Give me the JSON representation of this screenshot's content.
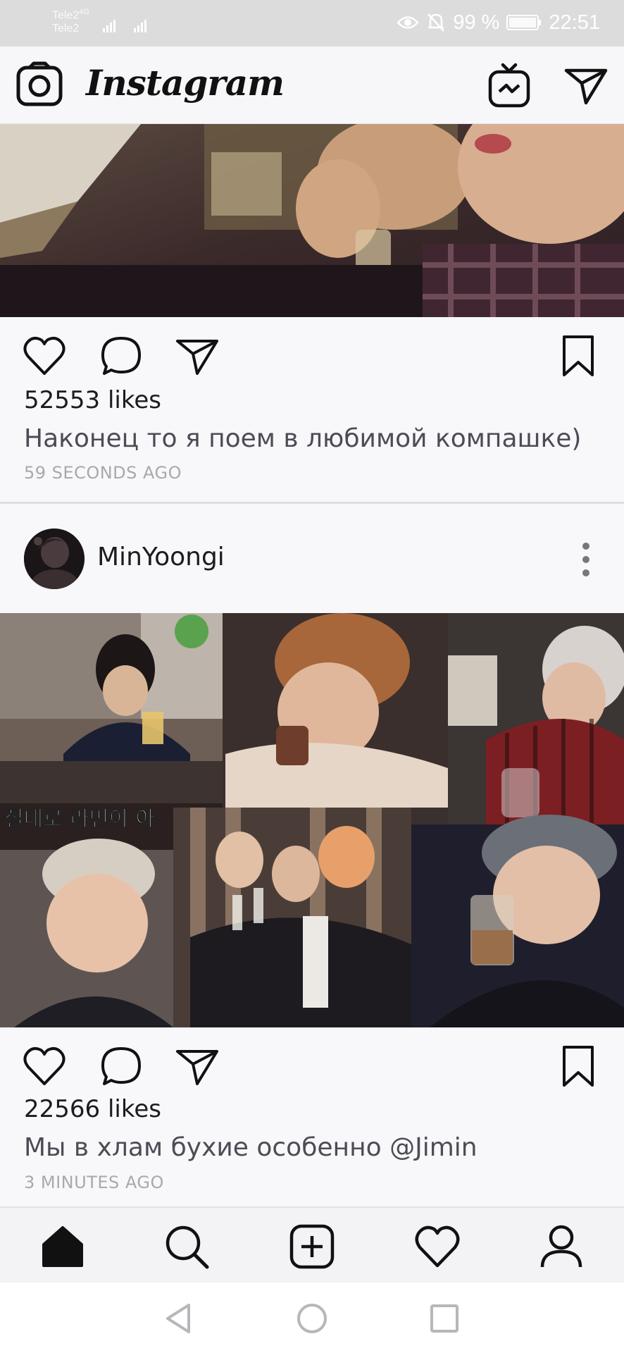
{
  "status_bar": {
    "carrier1": "Tele2",
    "network": "4G",
    "carrier2": "Tele2",
    "battery": "99 %",
    "time": "22:51",
    "icons": [
      "signal-icon",
      "eye-icon",
      "mute-icon",
      "battery-icon"
    ]
  },
  "header": {
    "logo": "Instagram",
    "icons": [
      "camera-icon",
      "igtv-icon",
      "direct-icon"
    ]
  },
  "post1": {
    "likes": "52553 likes",
    "caption": "Наконец то я поем в любимой компашке)",
    "time": "59 SECONDS AGO"
  },
  "post2": {
    "username": "MinYoongi",
    "likes": "22566 likes",
    "caption": "Мы в хлам бухие особенно @Jimin",
    "time": "3 MINUTES AGO",
    "image_text": "절대로 라면이 아"
  },
  "bottom_nav": {
    "items": [
      "home-icon",
      "search-icon",
      "add-icon",
      "heart-icon",
      "profile-icon"
    ]
  },
  "system_nav": {
    "items": [
      "back-icon",
      "home-circle-icon",
      "recents-icon"
    ]
  },
  "colors": {
    "background": "#f8f7fa",
    "status_bar": "#dcdcdd",
    "caption_text": "#4d4c55",
    "timestamp_text": "#a9a8ad"
  }
}
